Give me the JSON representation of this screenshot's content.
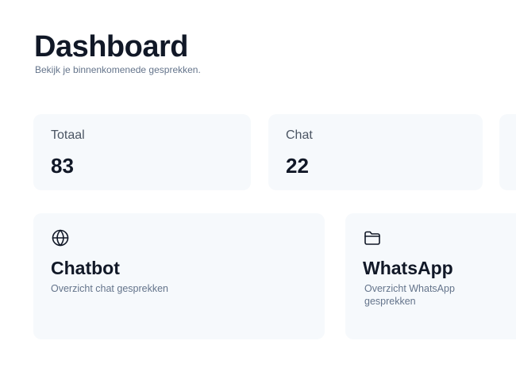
{
  "header": {
    "title": "Dashboard",
    "subtitle": "Bekijk je binnenkomenede gesprekken."
  },
  "stats": [
    {
      "label": "Totaal",
      "value": "83"
    },
    {
      "label": "Chat",
      "value": "22"
    },
    {
      "label": "",
      "value": ""
    }
  ],
  "nav_cards": [
    {
      "icon": "globe-icon",
      "title": "Chatbot",
      "description": "Overzicht chat gesprekken"
    },
    {
      "icon": "folder-icon",
      "title": "WhatsApp",
      "description": "Overzicht WhatsApp gesprekken"
    }
  ],
  "colors": {
    "card_background": "#f6f9fc",
    "title_text": "#111827",
    "muted_text": "#64748b"
  }
}
